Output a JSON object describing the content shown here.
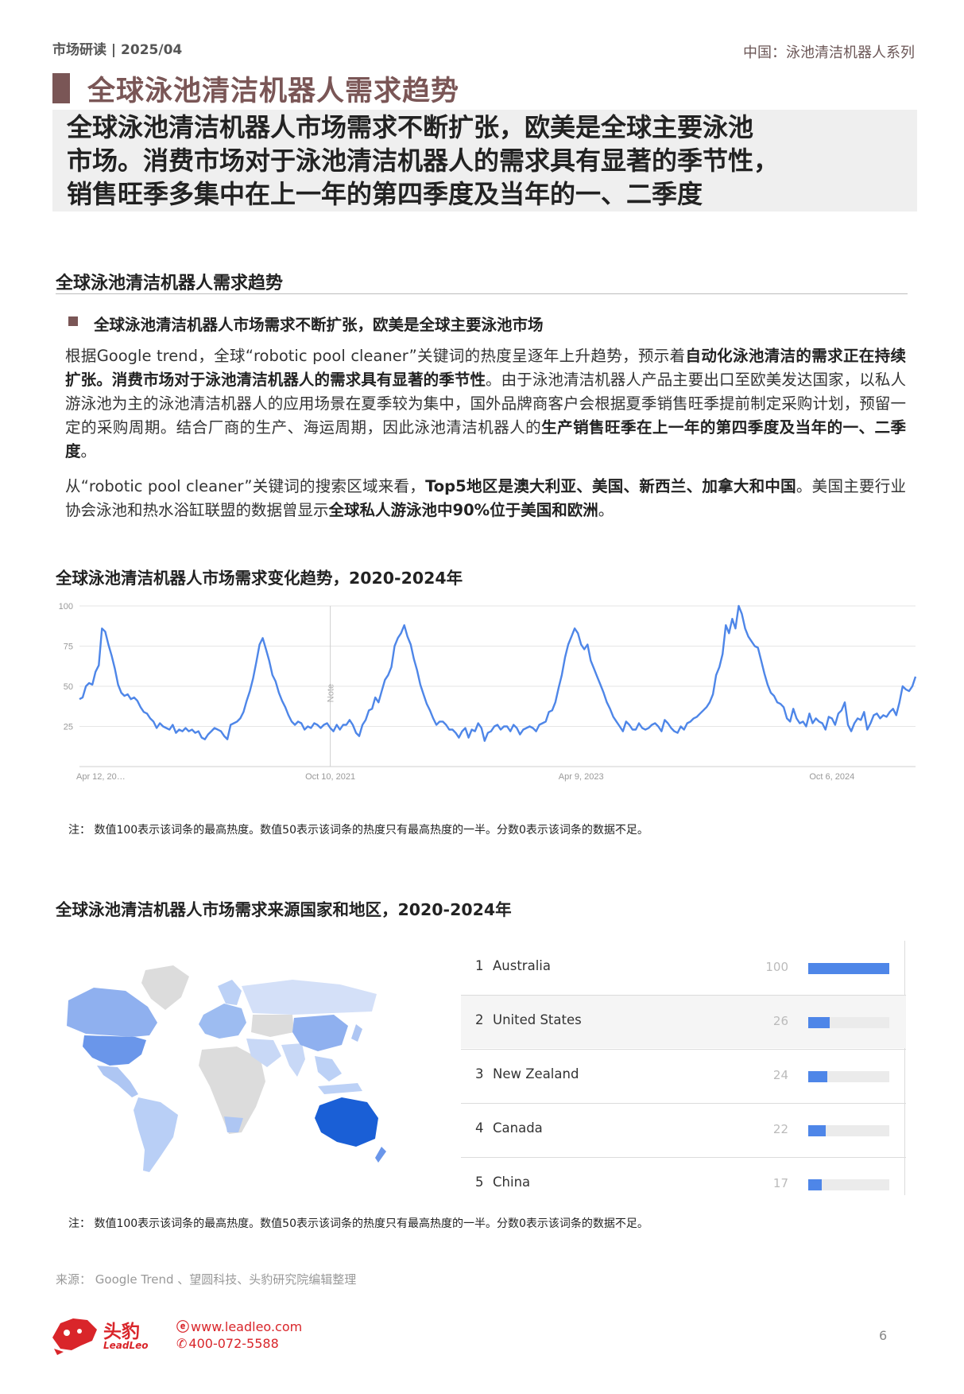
{
  "header": {
    "left": "市场研读 | 2025/04",
    "right": "中国：泳池清洁机器人系列"
  },
  "title": "全球泳池清洁机器人需求趋势",
  "subtitle": [
    "全球泳池清洁机器人市场需求不断扩张，欧美是全球主要泳池",
    "市场。消费市场对于泳池清洁机器人的需求具有显著的季节性，",
    "销售旺季多集中在上一年的第四季度及当年的一、二季度"
  ],
  "section": {
    "title": "全球泳池清洁机器人需求趋势",
    "bullet": "全球泳池清洁机器人市场需求不断扩张，欧美是全球主要泳池市场",
    "p1": {
      "a": "根据Google trend，全球“robotic pool cleaner”关键词的热度呈逐年上升趋势，预示着",
      "b": "自动化泳池清洁的需求正在持续扩张。消费市场对于泳池清洁机器人的需求具有显著的季节性",
      "c": "。由于泳池清洁机器人产品主要出口至欧美发达国家，以私人游泳池为主的泳池清洁机器人的应用场景在夏季较为集中，国外品牌商客户会根据夏季销售旺季提前制定采购计划，预留一定的采购周期。结合厂商的生产、海运周期，因此泳池清洁机器人的",
      "d": "生产销售旺季在上一年的第四季度及当年的一、二季度",
      "e": "。"
    },
    "p2": {
      "a": "从“robotic pool cleaner”关键词的搜索区域来看，",
      "b": "Top5地区是澳大利亚、美国、新西兰、加拿大和中国",
      "c": "。美国主要行业协会泳池和热水浴缸联盟的数据曾显示",
      "d": "全球私人游泳池中90%位于美国和欧洲",
      "e": "。"
    }
  },
  "figure1": {
    "title": "全球泳池清洁机器人市场需求变化趋势，2020-2024年",
    "note": "注：  数值100表示该词条的最高热度。数值50表示该词条的热度只有最高热度的一半。分数0表示该词条的数据不足。"
  },
  "figure2": {
    "title": "全球泳池清洁机器人市场需求来源国家和地区，2020-2024年",
    "note": "注：  数值100表示该词条的最高热度。数值50表示该词条的热度只有最高热度的一半。分数0表示该词条的数据不足。",
    "ranking": [
      {
        "rank": "1",
        "name": "Australia",
        "value": 100
      },
      {
        "rank": "2",
        "name": "United States",
        "value": 26
      },
      {
        "rank": "3",
        "name": "New Zealand",
        "value": 24
      },
      {
        "rank": "4",
        "name": "Canada",
        "value": 22
      },
      {
        "rank": "5",
        "name": "China",
        "value": 17
      }
    ]
  },
  "source": "来源：   Google Trend 、望圆科技、头豹研究院编辑整理",
  "logo": {
    "cn": "头豹",
    "en": "LeadLeo"
  },
  "contact": {
    "web": "www.leadleo.com",
    "phone": "400-072-5588"
  },
  "page_number": "6",
  "colors": {
    "brand": "#7a5656",
    "accent": "#4e86e8",
    "logo_red": "#d9252a"
  },
  "chart_data": {
    "type": "line",
    "title": "",
    "xlabel": "",
    "ylabel": "",
    "ylim": [
      0,
      100
    ],
    "yticks": [
      "100",
      "75",
      "50",
      "25"
    ],
    "xticks": [
      {
        "label": "Apr 12, 20…",
        "index": 0
      },
      {
        "label": "Oct 10, 2021",
        "index": 78
      },
      {
        "label": "Apr 9, 2023",
        "index": 156
      },
      {
        "label": "Oct 6, 2024",
        "index": 234
      }
    ],
    "annotation": {
      "label": "Note",
      "index": 78
    },
    "grid": true,
    "series": [
      {
        "values": [
          42,
          43,
          50,
          52,
          51,
          59,
          63,
          86,
          84,
          76,
          69,
          61,
          51,
          46,
          44,
          45,
          42,
          43,
          41,
          37,
          34,
          33,
          30,
          28,
          24,
          27,
          25,
          24,
          23,
          26,
          21,
          23,
          22,
          24,
          22,
          23,
          21,
          22,
          18,
          17,
          20,
          22,
          24,
          23,
          22,
          19,
          17,
          26,
          27,
          28,
          30,
          34,
          41,
          47,
          55,
          65,
          76,
          80,
          73,
          66,
          57,
          53,
          46,
          41,
          37,
          32,
          28,
          26,
          28,
          27,
          23,
          25,
          24,
          27,
          26,
          24,
          26,
          27,
          24,
          22,
          26,
          23,
          26,
          26,
          29,
          26,
          21,
          19,
          26,
          29,
          35,
          36,
          43,
          40,
          47,
          54,
          57,
          62,
          75,
          80,
          83,
          88,
          81,
          76,
          67,
          60,
          51,
          45,
          39,
          35,
          30,
          26,
          28,
          28,
          26,
          23,
          23,
          21,
          18,
          22,
          24,
          18,
          23,
          22,
          27,
          24,
          16,
          21,
          22,
          25,
          26,
          23,
          25,
          25,
          22,
          26,
          24,
          20,
          23,
          24,
          25,
          24,
          22,
          26,
          27,
          28,
          34,
          35,
          40,
          49,
          57,
          68,
          76,
          81,
          86,
          83,
          76,
          73,
          76,
          66,
          61,
          56,
          51,
          46,
          40,
          36,
          31,
          28,
          25,
          22,
          28,
          26,
          23,
          23,
          27,
          24,
          23,
          24,
          26,
          27,
          25,
          22,
          29,
          27,
          24,
          22,
          21,
          25,
          23,
          27,
          28,
          30,
          31,
          33,
          35,
          37,
          40,
          45,
          57,
          62,
          70,
          88,
          83,
          92,
          86,
          100,
          95,
          86,
          81,
          78,
          75,
          74,
          66,
          58,
          51,
          46,
          44,
          40,
          39,
          37,
          30,
          28,
          36,
          30,
          27,
          28,
          25,
          33,
          27,
          30,
          28,
          27,
          23,
          31,
          30,
          26,
          33,
          35,
          40,
          26,
          22,
          27,
          30,
          29,
          34,
          23,
          27,
          32,
          33,
          30,
          32,
          31,
          34,
          36,
          32,
          40,
          50,
          48,
          47,
          50,
          56
        ]
      }
    ]
  }
}
